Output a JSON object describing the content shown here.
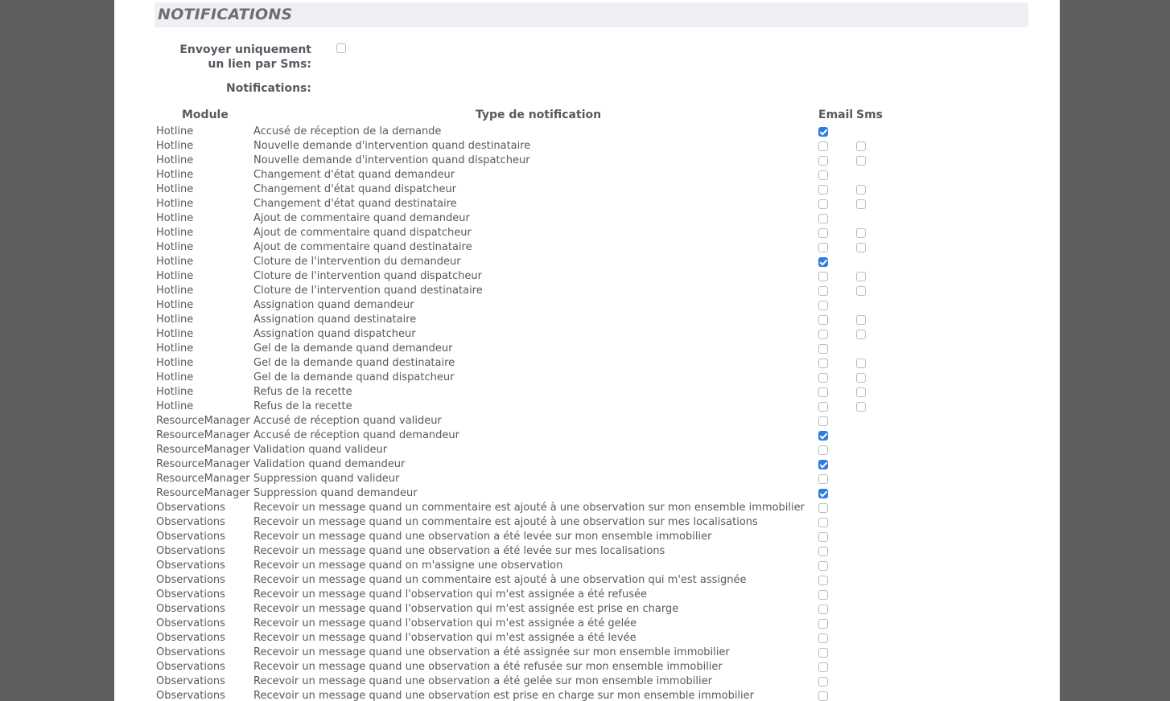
{
  "section": {
    "title": "NOTIFICATIONS"
  },
  "form": {
    "sms_link_label": "Envoyer uniquement un lien par Sms:",
    "sms_link_checked": false,
    "notifications_label": "Notifications:"
  },
  "table": {
    "headers": {
      "module": "Module",
      "type": "Type de notification",
      "email": "Email",
      "sms": "Sms"
    },
    "rows": [
      {
        "module": "Hotline",
        "type": "Accusé de réception de la demande",
        "email": true,
        "sms": null
      },
      {
        "module": "Hotline",
        "type": "Nouvelle demande d'intervention quand destinataire",
        "email": false,
        "sms": false
      },
      {
        "module": "Hotline",
        "type": "Nouvelle demande d'intervention quand dispatcheur",
        "email": false,
        "sms": false
      },
      {
        "module": "Hotline",
        "type": "Changement d'état quand demandeur",
        "email": false,
        "sms": null
      },
      {
        "module": "Hotline",
        "type": "Changement d'état quand dispatcheur",
        "email": false,
        "sms": false
      },
      {
        "module": "Hotline",
        "type": "Changement d'état quand destinataire",
        "email": false,
        "sms": false
      },
      {
        "module": "Hotline",
        "type": "Ajout de commentaire quand demandeur",
        "email": false,
        "sms": null
      },
      {
        "module": "Hotline",
        "type": "Ajout de commentaire quand dispatcheur",
        "email": false,
        "sms": false
      },
      {
        "module": "Hotline",
        "type": "Ajout de commentaire quand destinataire",
        "email": false,
        "sms": false
      },
      {
        "module": "Hotline",
        "type": "Cloture de l'intervention du demandeur",
        "email": true,
        "sms": null
      },
      {
        "module": "Hotline",
        "type": "Cloture de l'intervention quand dispatcheur",
        "email": false,
        "sms": false
      },
      {
        "module": "Hotline",
        "type": "Cloture de l'intervention quand destinataire",
        "email": false,
        "sms": false
      },
      {
        "module": "Hotline",
        "type": "Assignation quand demandeur",
        "email": false,
        "sms": null
      },
      {
        "module": "Hotline",
        "type": "Assignation quand destinataire",
        "email": false,
        "sms": false
      },
      {
        "module": "Hotline",
        "type": "Assignation quand dispatcheur",
        "email": false,
        "sms": false
      },
      {
        "module": "Hotline",
        "type": "Gel de la demande quand demandeur",
        "email": false,
        "sms": null
      },
      {
        "module": "Hotline",
        "type": "Gel de la demande quand destinataire",
        "email": false,
        "sms": false
      },
      {
        "module": "Hotline",
        "type": "Gel de la demande quand dispatcheur",
        "email": false,
        "sms": false
      },
      {
        "module": "Hotline",
        "type": "Refus de la recette",
        "email": false,
        "sms": false
      },
      {
        "module": "Hotline",
        "type": "Refus de la recette",
        "email": false,
        "sms": false
      },
      {
        "module": "ResourceManager",
        "type": "Accusé de réception quand valideur",
        "email": false,
        "sms": null
      },
      {
        "module": "ResourceManager",
        "type": "Accusé de réception quand demandeur",
        "email": true,
        "sms": null
      },
      {
        "module": "ResourceManager",
        "type": "Validation quand valideur",
        "email": false,
        "sms": null
      },
      {
        "module": "ResourceManager",
        "type": "Validation quand demandeur",
        "email": true,
        "sms": null
      },
      {
        "module": "ResourceManager",
        "type": "Suppression quand valideur",
        "email": false,
        "sms": null
      },
      {
        "module": "ResourceManager",
        "type": "Suppression quand demandeur",
        "email": true,
        "sms": null
      },
      {
        "module": "Observations",
        "type": "Recevoir un message quand un commentaire est ajouté à une observation sur mon ensemble immobilier",
        "email": false,
        "sms": null
      },
      {
        "module": "Observations",
        "type": "Recevoir un message quand un commentaire est ajouté à une observation sur mes localisations",
        "email": false,
        "sms": null
      },
      {
        "module": "Observations",
        "type": "Recevoir un message quand une observation a été levée sur mon ensemble immobilier",
        "email": false,
        "sms": null
      },
      {
        "module": "Observations",
        "type": "Recevoir un message quand une observation a été levée sur mes localisations",
        "email": false,
        "sms": null
      },
      {
        "module": "Observations",
        "type": "Recevoir un message quand on m'assigne une observation",
        "email": false,
        "sms": null
      },
      {
        "module": "Observations",
        "type": "Recevoir un message quand un commentaire est ajouté à une observation qui m'est assignée",
        "email": false,
        "sms": null
      },
      {
        "module": "Observations",
        "type": "Recevoir un message quand l'observation qui m'est assignée a été refusée",
        "email": false,
        "sms": null
      },
      {
        "module": "Observations",
        "type": "Recevoir un message quand l'observation qui m'est assignée est prise en charge",
        "email": false,
        "sms": null
      },
      {
        "module": "Observations",
        "type": "Recevoir un message quand l'observation qui m'est assignée a été gelée",
        "email": false,
        "sms": null
      },
      {
        "module": "Observations",
        "type": "Recevoir un message quand l'observation qui m'est assignée a été levée",
        "email": false,
        "sms": null
      },
      {
        "module": "Observations",
        "type": "Recevoir un message quand une observation a été assignée sur mon ensemble immobilier",
        "email": false,
        "sms": null
      },
      {
        "module": "Observations",
        "type": "Recevoir un message quand une observation a été refusée sur mon ensemble immobilier",
        "email": false,
        "sms": null
      },
      {
        "module": "Observations",
        "type": "Recevoir un message quand une observation a été gelée sur mon ensemble immobilier",
        "email": false,
        "sms": null
      },
      {
        "module": "Observations",
        "type": "Recevoir un message quand une observation est prise en charge sur mon ensemble immobilier",
        "email": false,
        "sms": null
      }
    ]
  }
}
